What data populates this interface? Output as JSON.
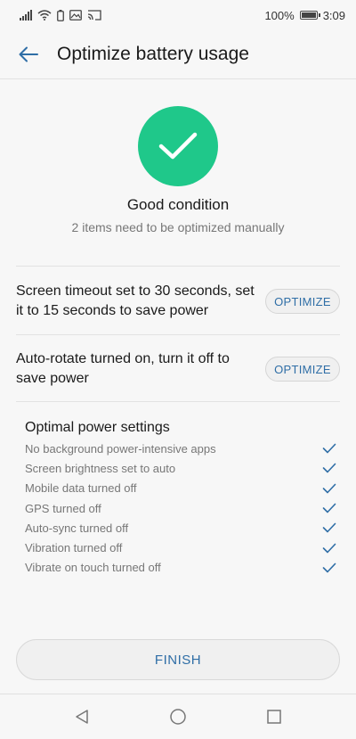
{
  "status_bar": {
    "battery_percent": "100%",
    "time": "3:09"
  },
  "header": {
    "title": "Optimize battery usage"
  },
  "status": {
    "title": "Good condition",
    "subtitle": "2 items need to be optimized manually"
  },
  "optimize_items": [
    {
      "text": "Screen timeout set to 30 seconds, set it to 15 seconds to save power",
      "button": "OPTIMIZE"
    },
    {
      "text": "Auto-rotate turned on, turn it off to save power",
      "button": "OPTIMIZE"
    }
  ],
  "optimal": {
    "title": "Optimal power settings",
    "items": [
      "No background power-intensive apps",
      "Screen brightness set to auto",
      "Mobile data turned off",
      "GPS turned off",
      "Auto-sync turned off",
      "Vibration turned off",
      "Vibrate on touch turned off"
    ]
  },
  "finish_label": "FINISH",
  "colors": {
    "accent": "#2f6ea6",
    "success": "#1fc88a"
  }
}
